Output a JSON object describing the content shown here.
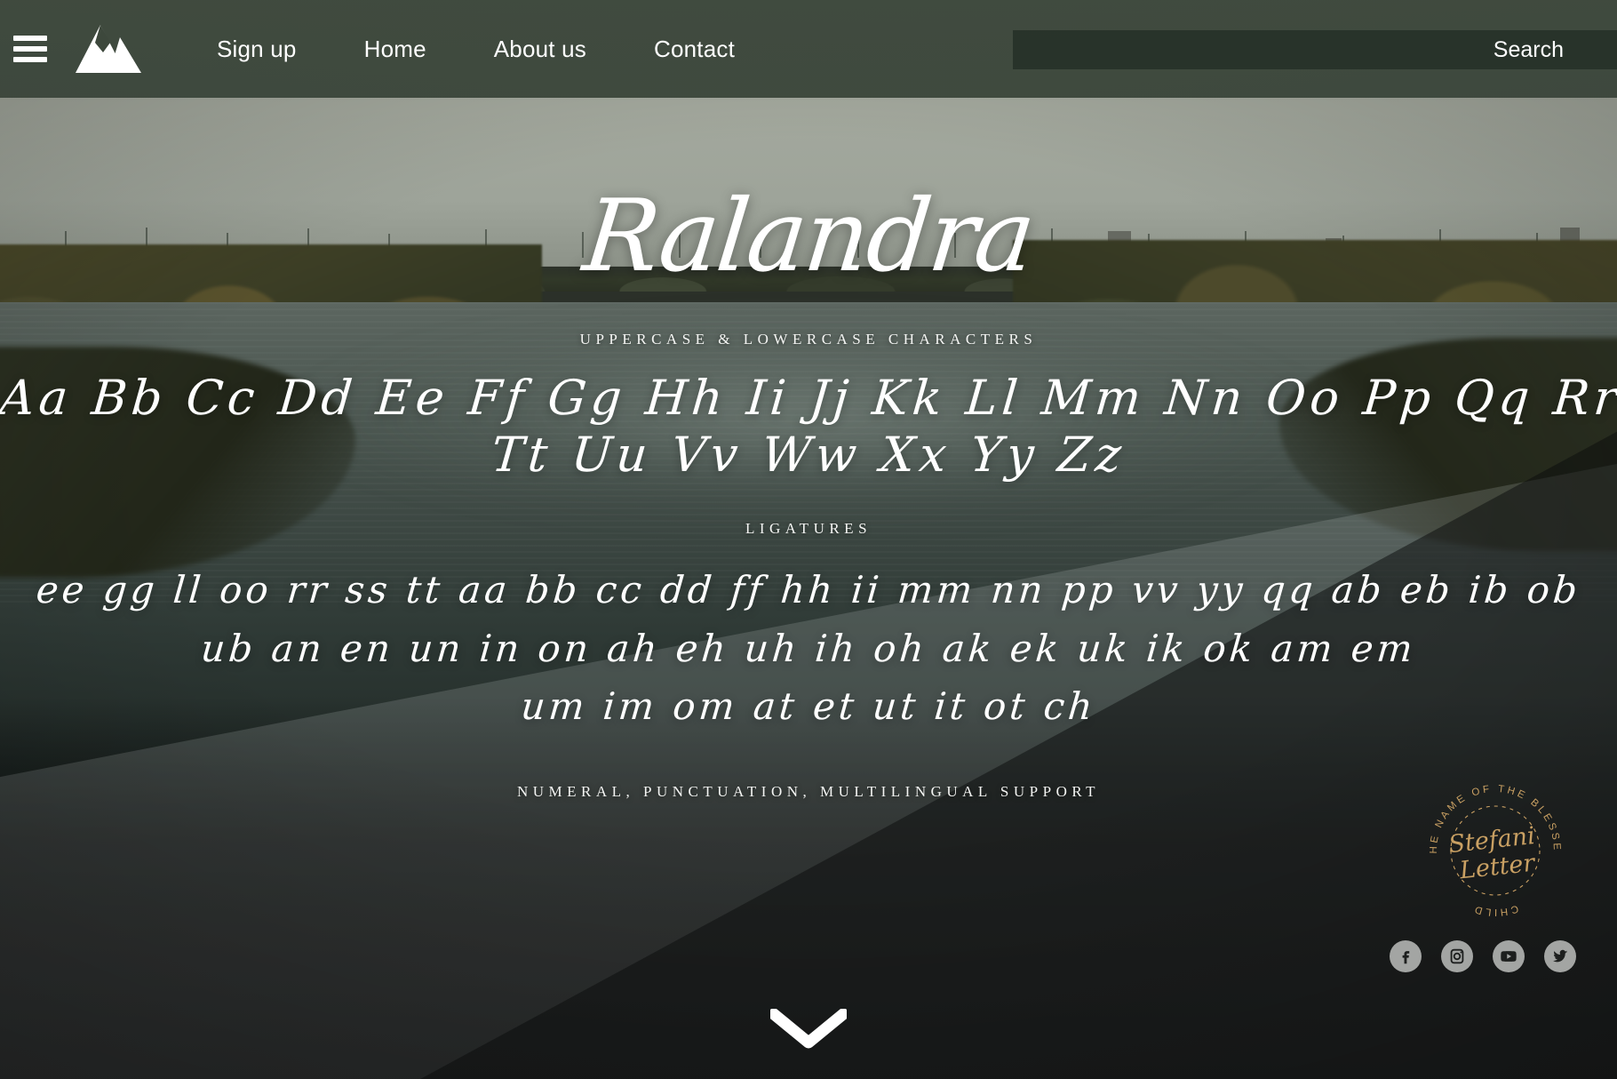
{
  "navbar": {
    "menu_icon": "hamburger-menu-icon",
    "logo_icon": "mountain-logo-icon",
    "links": [
      {
        "label": "Sign up"
      },
      {
        "label": "Home"
      },
      {
        "label": "About us"
      },
      {
        "label": "Contact"
      }
    ],
    "search": {
      "placeholder": "Search",
      "value": ""
    }
  },
  "hero": {
    "font_name": "Ralandra",
    "sections": [
      {
        "label": "UPPERCASE & LOWERCASE CHARACTERS"
      },
      {
        "label": "LIGATURES"
      },
      {
        "label": "NUMERAL, PUNCTUATION, MULTILINGUAL SUPPORT"
      }
    ],
    "alphabet_rows": [
      "Aa Bb Cc Dd Ee Ff Gg Hh Ii Jj Kk Ll Mm Nn Oo Pp Qq Rr Ss",
      "Tt Uu Vv Ww Xx Yy Zz"
    ],
    "ligature_rows": [
      "ee gg ll oo rr ss tt aa bb cc dd ff hh ii mm nn pp vv yy qq ab eb ib ob",
      "ub an en un in on ah eh uh ih oh ak ek uk ik ok am em",
      "um im om at et ut it ot ch"
    ]
  },
  "badge": {
    "ring_text_top": "THE NAME OF THE BLESSED",
    "ring_text_bottom": "CHILD",
    "ring_text_full": "THE NAME OF THE BLESSED CHILD",
    "script_line_1": "Stefani",
    "script_line_2": "Letter",
    "color": "#c9a063"
  },
  "socials": [
    {
      "name": "facebook",
      "icon": "facebook-icon"
    },
    {
      "name": "instagram",
      "icon": "instagram-icon"
    },
    {
      "name": "youtube",
      "icon": "youtube-icon"
    },
    {
      "name": "twitter",
      "icon": "twitter-icon"
    }
  ],
  "scroll_indicator": {
    "icon": "chevron-down-icon"
  },
  "colors": {
    "navbar_bg": "#3d483c",
    "search_bg": "#16201a",
    "text_on_dark": "#ffffff",
    "badge_gold": "#c9a063",
    "social_circle": "#a3a5a3"
  }
}
